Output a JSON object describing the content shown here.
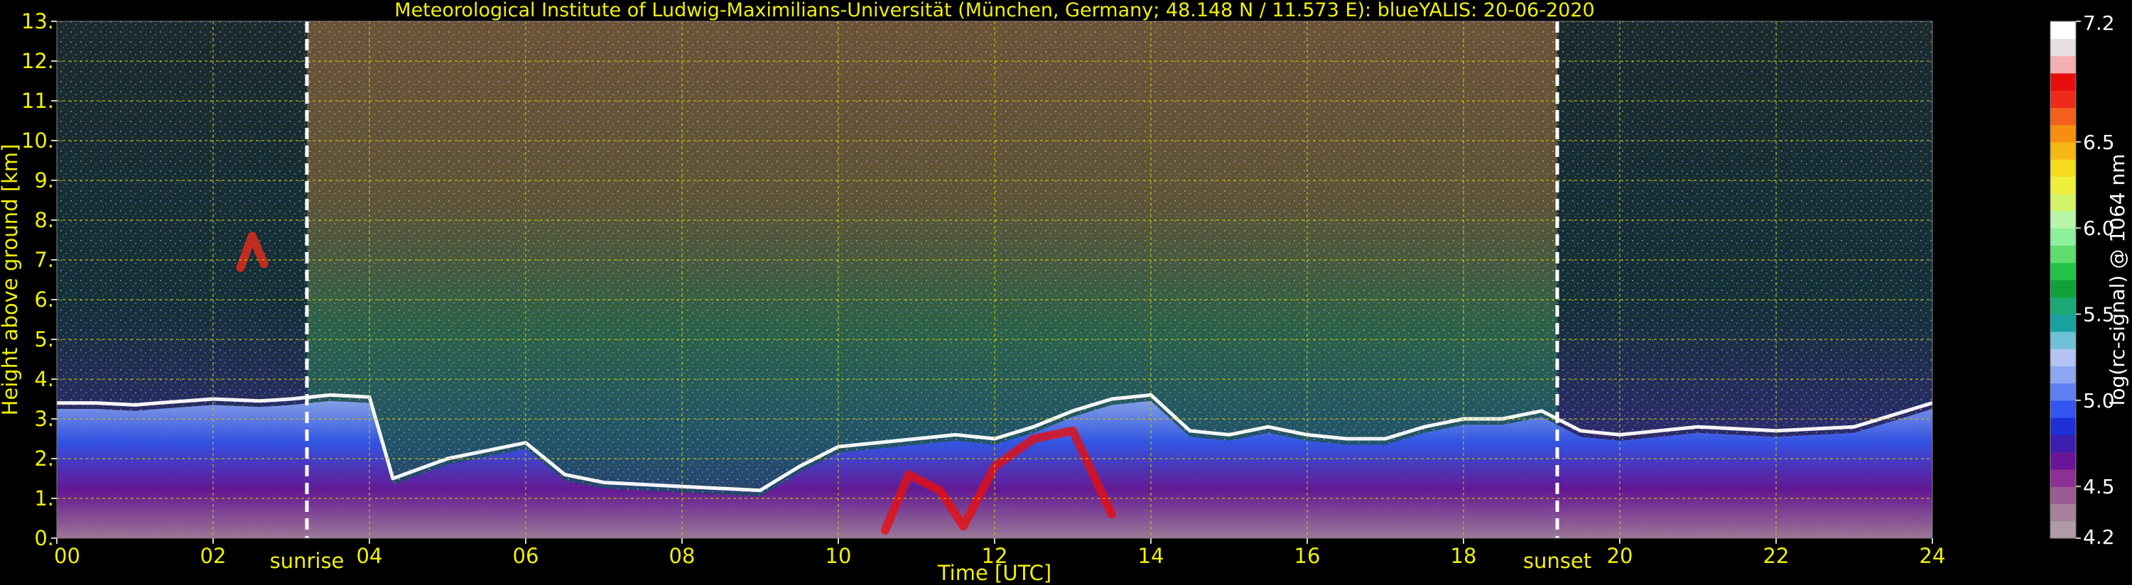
{
  "chart_data": {
    "type": "heatmap",
    "title": "Meteorological Institute of Ludwig-Maximilians-Universität (München, Germany; 48.148 N / 11.573 E):    blueYALIS: 20-06-2020",
    "xlabel": "Time [UTC]",
    "ylabel": "Height above ground [km]",
    "xlim": [
      0,
      24
    ],
    "ylim": [
      0,
      13
    ],
    "x_ticks": [
      {
        "value": 0,
        "label": "00"
      },
      {
        "value": 2,
        "label": "02"
      },
      {
        "value": 4,
        "label": "04"
      },
      {
        "value": 6,
        "label": "06"
      },
      {
        "value": 8,
        "label": "08"
      },
      {
        "value": 10,
        "label": "10"
      },
      {
        "value": 12,
        "label": "12"
      },
      {
        "value": 14,
        "label": "14"
      },
      {
        "value": 16,
        "label": "16"
      },
      {
        "value": 18,
        "label": "18"
      },
      {
        "value": 20,
        "label": "20"
      },
      {
        "value": 22,
        "label": "22"
      },
      {
        "value": 24,
        "label": "24"
      }
    ],
    "y_ticks": [
      {
        "value": 0,
        "label": "0."
      },
      {
        "value": 1,
        "label": "1."
      },
      {
        "value": 2,
        "label": "2."
      },
      {
        "value": 3,
        "label": "3."
      },
      {
        "value": 4,
        "label": "4."
      },
      {
        "value": 5,
        "label": "5."
      },
      {
        "value": 6,
        "label": "6."
      },
      {
        "value": 7,
        "label": "7."
      },
      {
        "value": 8,
        "label": "8."
      },
      {
        "value": 9,
        "label": "9."
      },
      {
        "value": 10,
        "label": "10."
      },
      {
        "value": 11,
        "label": "11."
      },
      {
        "value": 12,
        "label": "12."
      },
      {
        "value": 13,
        "label": "13."
      }
    ],
    "grid": true,
    "annotations": [
      {
        "name": "sunrise",
        "label": "sunrise",
        "x": 3.2
      },
      {
        "name": "sunset",
        "label": "sunset",
        "x": 19.2
      }
    ],
    "colorbar": {
      "label": "log(rc-signal) @ 1064 nm",
      "min": 4.2,
      "max": 7.2,
      "ticks": [
        {
          "value": 4.2,
          "label": "4.2"
        },
        {
          "value": 4.5,
          "label": "4.5"
        },
        {
          "value": 5.0,
          "label": "5.0"
        },
        {
          "value": 5.5,
          "label": "5.5"
        },
        {
          "value": 6.0,
          "label": "6.0"
        },
        {
          "value": 6.5,
          "label": "6.5"
        },
        {
          "value": 7.2,
          "label": "7.2"
        }
      ],
      "colors": [
        "#b09aa8",
        "#a7809c",
        "#9a5a92",
        "#8e2f96",
        "#6a1597",
        "#3b1eae",
        "#1e2fd8",
        "#3356f0",
        "#5f7ff0",
        "#8da6f2",
        "#b3c4f4",
        "#6ec0d6",
        "#19a0a0",
        "#1aa874",
        "#12a03a",
        "#22c44a",
        "#5fdc6e",
        "#8ef09c",
        "#b8f5a8",
        "#d4f46a",
        "#eef03c",
        "#f4dc1c",
        "#f6b614",
        "#f68e10",
        "#f2601c",
        "#ee2a1a",
        "#e80e0e",
        "#f4b0b0",
        "#e8e0e0",
        "#ffffff"
      ]
    },
    "regimes": [
      {
        "name": "night",
        "start": 0,
        "end": 3.2
      },
      {
        "name": "day",
        "start": 3.2,
        "end": 19.2
      },
      {
        "name": "night",
        "start": 19.2,
        "end": 24
      }
    ],
    "layers": [
      {
        "name": "residual-layer-top",
        "type": "line",
        "color": "#ffffff",
        "x": [
          0,
          0.5,
          1,
          1.3,
          2,
          2.6,
          3.0,
          3.5,
          4.0,
          4.3,
          5.0,
          5.5,
          6.0,
          6.5,
          7.0,
          8.0,
          9.0,
          9.5,
          10.0,
          10.5,
          11.0,
          11.5,
          12.0,
          12.5,
          13.0,
          13.5,
          14.0,
          14.5,
          15.0,
          15.5,
          16.0,
          16.5,
          17.0,
          17.5,
          18.0,
          18.5,
          19.0,
          19.5,
          20.0,
          21.0,
          22.0,
          23.0,
          24.0
        ],
        "y": [
          3.4,
          3.4,
          3.35,
          3.4,
          3.5,
          3.45,
          3.5,
          3.6,
          3.55,
          1.5,
          2.0,
          2.2,
          2.4,
          1.6,
          1.4,
          1.3,
          1.2,
          1.8,
          2.3,
          2.4,
          2.5,
          2.6,
          2.5,
          2.8,
          3.2,
          3.5,
          3.6,
          2.7,
          2.6,
          2.8,
          2.6,
          2.5,
          2.5,
          2.8,
          3.0,
          3.0,
          3.2,
          2.7,
          2.6,
          2.8,
          2.7,
          2.8,
          3.4
        ]
      },
      {
        "name": "elevated-aerosol",
        "type": "line",
        "color": "#ee2a1a",
        "x": [
          2.35,
          2.5,
          2.65
        ],
        "y": [
          6.8,
          7.6,
          6.9
        ]
      },
      {
        "name": "strong-signal-boundary-layer",
        "type": "line",
        "color": "#e80e0e",
        "x": [
          10.6,
          10.9,
          11.3,
          11.6,
          12.0,
          12.5,
          13.0,
          13.5
        ],
        "y": [
          0.2,
          1.6,
          1.2,
          0.3,
          1.8,
          2.5,
          2.7,
          0.6
        ]
      }
    ]
  }
}
